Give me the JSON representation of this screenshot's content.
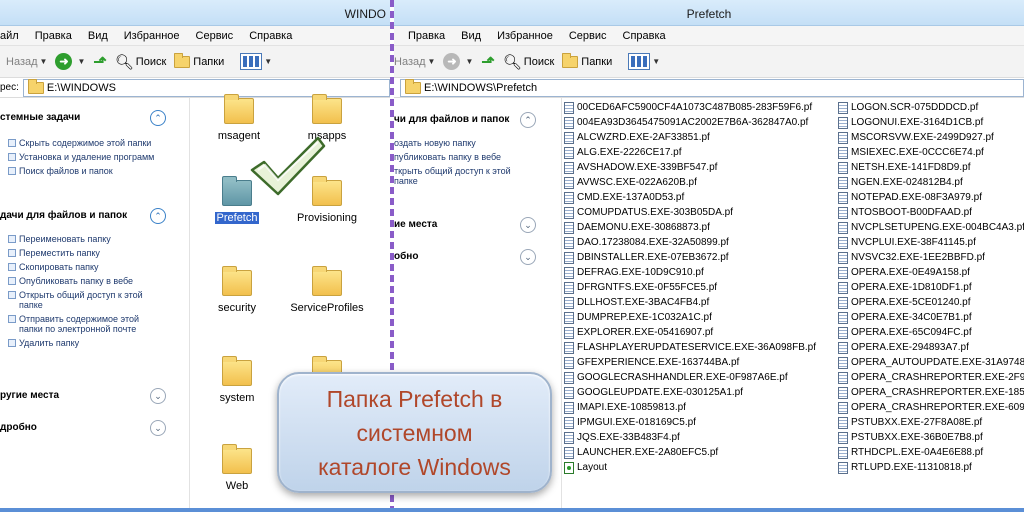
{
  "left_window": {
    "title": "WINDO",
    "menu": [
      "айл",
      "Правка",
      "Вид",
      "Избранное",
      "Сервис",
      "Справка"
    ],
    "toolbar": {
      "back_label": "Назад",
      "search_label": "Поиск",
      "folders_label": "Папки"
    },
    "address": {
      "label": "рес:",
      "path": "E:\\WINDOWS"
    },
    "tasks": {
      "system": {
        "title": "стемные задачи",
        "items": [
          "Скрыть содержимое этой папки",
          "Установка и удаление программ",
          "Поиск файлов и папок"
        ]
      },
      "file": {
        "title": "дачи для файлов и папок",
        "items": [
          "Переименовать папку",
          "Переместить папку",
          "Скопировать папку",
          "Опубликовать папку в вебе",
          "Открыть общий доступ к этой папке",
          "Отправить содержимое этой папки по электронной почте",
          "Удалить папку"
        ]
      },
      "other_places": "ругие места",
      "details": "дробно"
    },
    "folders": [
      "msagent",
      "msapps",
      "Prefetch",
      "Provisioning",
      "security",
      "ServiceProfiles",
      "system",
      "",
      "Web",
      ""
    ]
  },
  "right_window": {
    "title": "Prefetch",
    "menu": [
      "Правка",
      "Вид",
      "Избранное",
      "Сервис",
      "Справка"
    ],
    "toolbar": {
      "back_label": "Назад",
      "search_label": "Поиск",
      "folders_label": "Папки"
    },
    "address": {
      "path": "E:\\WINDOWS\\Prefetch"
    },
    "tasks": {
      "file_title": "чи для файлов и папок",
      "file_items": [
        "оздать новую папку",
        "публиковать папку в вебе",
        "ткрыть общий доступ к этой папке"
      ],
      "other_places": "ие места",
      "details": "обно"
    },
    "files_col1": [
      "00CED6AFC5900CF4A1073C487B085-283F59F6.pf",
      "004EA93D3645475091AC2002E7B6A-362847A0.pf",
      "ALCWZRD.EXE-2AF33851.pf",
      "ALG.EXE-2226CE17.pf",
      "AVSHADOW.EXE-339BF547.pf",
      "AVWSC.EXE-022A620B.pf",
      "CMD.EXE-137A0D53.pf",
      "COMUPDATUS.EXE-303B05DA.pf",
      "DAEMONU.EXE-30868873.pf",
      "DAO.17238084.EXE-32A50899.pf",
      "DBINSTALLER.EXE-07EB3672.pf",
      "DEFRAG.EXE-10D9C910.pf",
      "DFRGNTFS.EXE-0F55FCE5.pf",
      "DLLHOST.EXE-3BAC4FB4.pf",
      "DUMPREP.EXE-1C032A1C.pf",
      "EXPLORER.EXE-05416907.pf",
      "FLASHPLAYERUPDATESERVICE.EXE-36A098FB.pf",
      "GFEXPERIENCE.EXE-163744BA.pf",
      "GOOGLECRASHHANDLER.EXE-0F987A6E.pf",
      "GOOGLEUPDATE.EXE-030125A1.pf",
      "IMAPI.EXE-10859813.pf",
      "IPMGUI.EXE-018169C5.pf",
      "JQS.EXE-33B483F4.pf",
      "LAUNCHER.EXE-2A80EFC5.pf",
      "Layout"
    ],
    "files_col2": [
      "LOGON.SCR-075DDDCD.pf",
      "LOGONUI.EXE-3164D1CB.pf",
      "MSCORSVW.EXE-2499D927.pf",
      "MSIEXEC.EXE-0CCC6E74.pf",
      "NETSH.EXE-141FD8D9.pf",
      "NGEN.EXE-024812B4.pf",
      "NOTEPAD.EXE-08F3A979.pf",
      "NTOSBOOT-B00DFAAD.pf",
      "NVCPLSETUPENG.EXE-004BC4A3.pf",
      "NVCPLUI.EXE-38F41145.pf",
      "NVSVC32.EXE-1EE2BBFD.pf",
      "OPERA.EXE-0E49A158.pf",
      "OPERA.EXE-1D810DF1.pf",
      "OPERA.EXE-5CE01240.pf",
      "OPERA.EXE-34C0E7B1.pf",
      "OPERA.EXE-65C094FC.pf",
      "OPERA.EXE-294893A7.pf",
      "OPERA_AUTOUPDATE.EXE-31A9748",
      "OPERA_CRASHREPORTER.EXE-2F94",
      "OPERA_CRASHREPORTER.EXE-1854",
      "OPERA_CRASHREPORTER.EXE-6094",
      "PSTUBXX.EXE-27F8A08E.pf",
      "PSTUBXX.EXE-36B0E7B8.pf",
      "RTHDCPL.EXE-0A4E6E88.pf",
      "RTLUPD.EXE-11310818.pf"
    ]
  },
  "callout": {
    "lines": [
      "Папка Prefetch в",
      "системном",
      "каталоге Windows"
    ]
  },
  "colors": {
    "accent": "#3366cc",
    "divider": "#8a5cc8",
    "callout_text": "#b0472a"
  }
}
